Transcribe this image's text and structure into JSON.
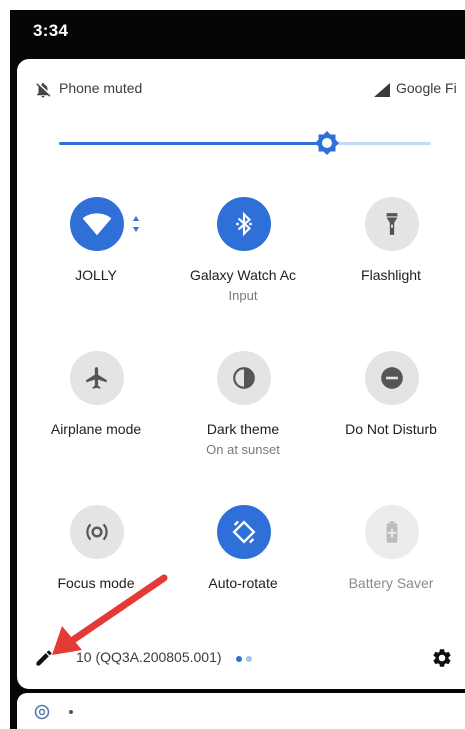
{
  "status_bar": {
    "time": "3:34"
  },
  "quick_settings": {
    "ringer_status": "Phone muted",
    "carrier": "Google Fi",
    "brightness_level": 0.72,
    "tiles": [
      {
        "label": "JOLLY",
        "sublabel": "",
        "state": "on",
        "icon": "wifi-icon"
      },
      {
        "label": "Galaxy Watch Ac",
        "sublabel": "Input",
        "state": "on",
        "icon": "bluetooth-icon"
      },
      {
        "label": "Flashlight",
        "sublabel": "",
        "state": "off",
        "icon": "flashlight-icon"
      },
      {
        "label": "Airplane mode",
        "sublabel": "",
        "state": "off",
        "icon": "airplane-icon"
      },
      {
        "label": "Dark theme",
        "sublabel": "On at sunset",
        "state": "off",
        "icon": "dark-theme-icon"
      },
      {
        "label": "Do Not Disturb",
        "sublabel": "",
        "state": "off",
        "icon": "do-not-disturb-icon"
      },
      {
        "label": "Focus mode",
        "sublabel": "",
        "state": "off",
        "icon": "focus-mode-icon"
      },
      {
        "label": "Auto-rotate",
        "sublabel": "",
        "state": "on",
        "icon": "auto-rotate-icon"
      },
      {
        "label": "Battery Saver",
        "sublabel": "",
        "state": "disabled",
        "icon": "battery-saver-icon"
      }
    ],
    "footer": {
      "build_number": "10 (QQ3A.200805.001)",
      "page_count": 2,
      "current_page": 1
    }
  },
  "colors": {
    "accent": "#2f6fd8",
    "tile_off": "#e4e4e4",
    "annotation_arrow": "#e53935"
  }
}
